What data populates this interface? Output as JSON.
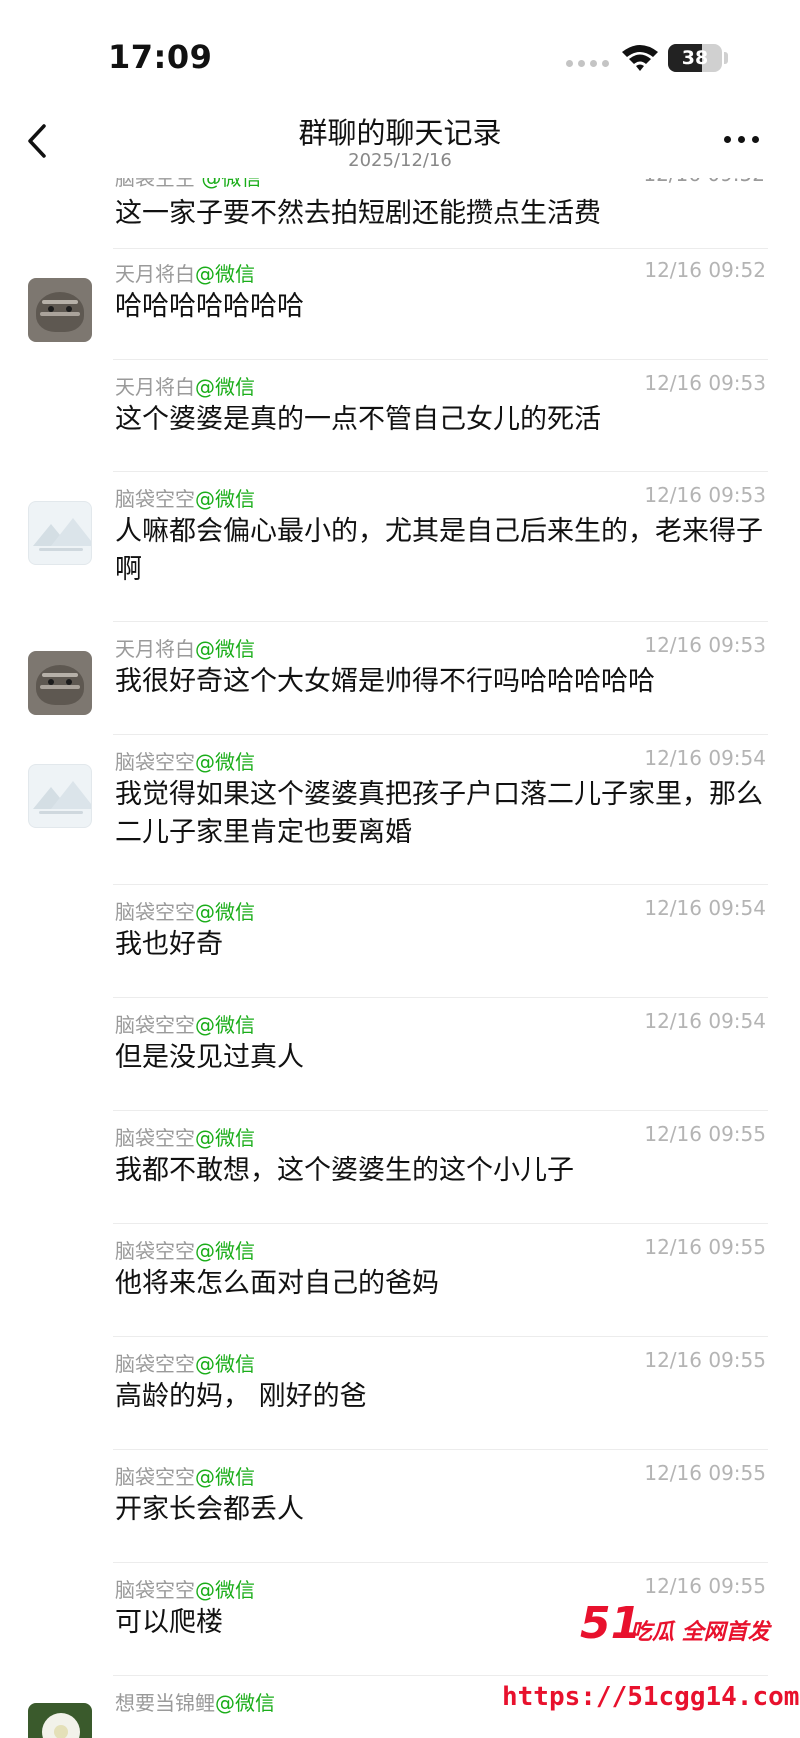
{
  "status_bar": {
    "time": "17:09",
    "battery": "38"
  },
  "nav": {
    "title": "群聊的聊天记录",
    "date": "2025/12/16"
  },
  "partial_top": {
    "text": "这一家子要不然去拍短剧还能攒点生活费"
  },
  "messages": [
    {
      "name": "天月将白",
      "source": "@微信",
      "time": "12/16 09:52",
      "text": "哈哈哈哈哈哈哈",
      "avatar": "cat-avatar"
    },
    {
      "name": "天月将白",
      "source": "@微信",
      "time": "12/16 09:53",
      "text": "这个婆婆是真的一点不管自己女儿的死活",
      "avatar": ""
    },
    {
      "name": "脑袋空空",
      "source": "@微信",
      "time": "12/16 09:53",
      "text": "人嘛都会偏心最小的，尤其是自己后来生的，老来得子啊",
      "avatar": "mountain-avatar"
    },
    {
      "name": "天月将白",
      "source": "@微信",
      "time": "12/16 09:53",
      "text": "我很好奇这个大女婿是帅得不行吗哈哈哈哈哈",
      "avatar": "cat-avatar"
    },
    {
      "name": "脑袋空空",
      "source": "@微信",
      "time": "12/16 09:54",
      "text": "我觉得如果这个婆婆真把孩子户口落二儿子家里，那么二儿子家里肯定也要离婚",
      "avatar": "mountain-avatar"
    },
    {
      "name": "脑袋空空",
      "source": "@微信",
      "time": "12/16 09:54",
      "text": "我也好奇",
      "avatar": ""
    },
    {
      "name": "脑袋空空",
      "source": "@微信",
      "time": "12/16 09:54",
      "text": "但是没见过真人",
      "avatar": ""
    },
    {
      "name": "脑袋空空",
      "source": "@微信",
      "time": "12/16 09:55",
      "text": "我都不敢想，这个婆婆生的这个小儿子",
      "avatar": ""
    },
    {
      "name": "脑袋空空",
      "source": "@微信",
      "time": "12/16 09:55",
      "text": "他将来怎么面对自己的爸妈",
      "avatar": ""
    },
    {
      "name": "脑袋空空",
      "source": "@微信",
      "time": "12/16 09:55",
      "text": "高龄的妈， 刚好的爸",
      "avatar": ""
    },
    {
      "name": "脑袋空空",
      "source": "@微信",
      "time": "12/16 09:55",
      "text": "开家长会都丢人",
      "avatar": ""
    },
    {
      "name": "脑袋空空",
      "source": "@微信",
      "time": "12/16 09:55",
      "text": "可以爬楼",
      "avatar": ""
    },
    {
      "name": "想要当锦鲤",
      "source": "@微信",
      "time": "",
      "text": "",
      "avatar": "flower-avatar"
    }
  ],
  "watermark": {
    "logo": "51",
    "slogan": "吃瓜 全网首发",
    "url": "https://51cgg14.com"
  },
  "colors": {
    "accent_green": "#1aad19",
    "watermark_red": "#e8112d"
  }
}
